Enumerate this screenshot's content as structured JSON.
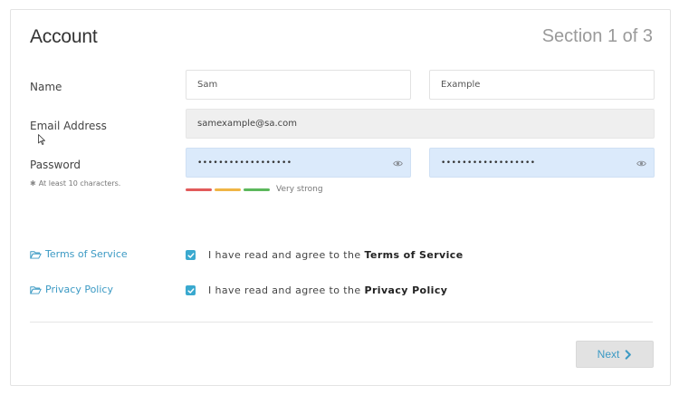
{
  "form": {
    "title": "Account",
    "section": "Section 1 of 3"
  },
  "name": {
    "label": "Name",
    "first": "Sam",
    "last": "Example"
  },
  "email": {
    "label": "Email Address",
    "value": "samexample@sa.com"
  },
  "password": {
    "label": "Password",
    "hint": "At least 10 characters.",
    "value_masked": "••••••••••••••••••",
    "confirm_masked": "••••••••••••••••••",
    "strength_label": "Very strong",
    "strength_colors": [
      "#e25b5b",
      "#f0b545",
      "#5cb85c"
    ]
  },
  "terms": {
    "link": "Terms of Service",
    "prefix": "I have read and agree to the",
    "bold": "Terms of Service",
    "checked": true
  },
  "privacy": {
    "link": "Privacy Policy",
    "prefix": "I have read and agree to the",
    "bold": "Privacy Policy",
    "checked": true
  },
  "actions": {
    "next_label": "Next",
    "next_icon": "chevron-right-icon"
  },
  "colors": {
    "accent": "#3c9ac4",
    "checkbox": "#3aa9cf",
    "password_bg": "#dbeafb"
  }
}
